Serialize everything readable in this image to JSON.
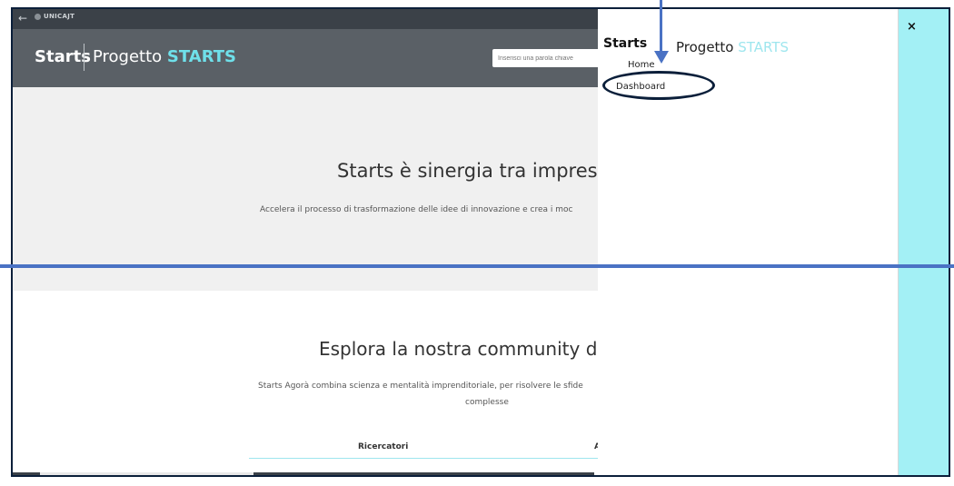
{
  "topstrip": {
    "back_icon": "←",
    "logo_text": "UNICAJT"
  },
  "header": {
    "brand": "Starts",
    "project_prefix": "Progetto",
    "project_highlight": "STARTS",
    "search_placeholder": "Inserisci una parola chiave"
  },
  "hero": {
    "title": "Starts è sinergia tra impresa e ri",
    "subtitle": "Accelera il processo di trasformazione delle idee di innovazione e crea i moc"
  },
  "community": {
    "title": "Esplora la nostra community d'ecc",
    "text_line1": "Starts Agorà combina scienza e mentalità imprenditoriale, per risolvere le sfide",
    "text_line2": "complesse",
    "tabs": [
      "Ricercatori",
      "A"
    ]
  },
  "overlay": {
    "brand": "Starts",
    "project_prefix": "Progetto",
    "project_highlight": "STARTS",
    "menu": [
      "Home",
      "Dashboard"
    ],
    "close_icon": "×"
  },
  "colors": {
    "header_bg": "#5a6066",
    "accent_cyan": "#6fe0ea",
    "annotation_blue": "#4a72c4",
    "annotation_navy": "#0b1f3a"
  }
}
